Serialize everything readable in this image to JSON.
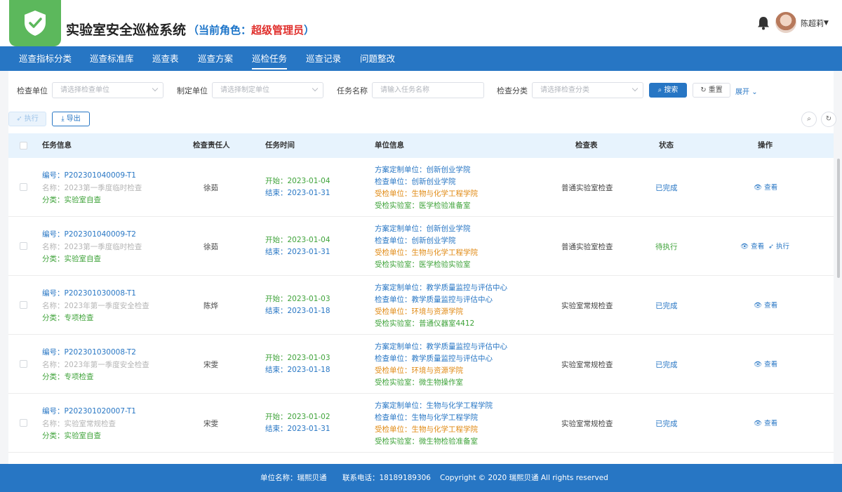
{
  "app": {
    "title": "实验室安全巡检系统",
    "role_prefix": "（当前角色：",
    "role_name": "超级管理员",
    "role_suffix": "）",
    "user_name": "陈超莉"
  },
  "nav": {
    "items": [
      "巡查指标分类",
      "巡查标准库",
      "巡查表",
      "巡查方案",
      "巡检任务",
      "巡查记录",
      "问题整改"
    ],
    "active": "巡检任务"
  },
  "filters": {
    "inspect_unit": {
      "label": "检查单位",
      "placeholder": "请选择检查单位"
    },
    "custom_unit": {
      "label": "制定单位",
      "placeholder": "请选择制定单位"
    },
    "task_name": {
      "label": "任务名称",
      "placeholder": "请输入任务名称"
    },
    "category": {
      "label": "检查分类",
      "placeholder": "请选择检查分类"
    },
    "search_label": "搜索",
    "reset_label": "重置",
    "expand_label": "展开"
  },
  "toolbar": {
    "execute_label": "执行",
    "export_label": "导出"
  },
  "table": {
    "headers": {
      "task": "任务信息",
      "person": "检查责任人",
      "time": "任务时间",
      "unit": "单位信息",
      "sheet": "检查表",
      "status": "状态",
      "action": "操作"
    },
    "rows": [
      {
        "code": "编号：P202301040009-T1",
        "name": "名称：2023第一季度临时检查",
        "category": "分类：实验室自查",
        "person": "徐茹",
        "start": "开始：2023-01-04",
        "end": "结束：2023-01-31",
        "plan_unit": "方案定制单位：创新创业学院",
        "inspect_unit": "检查单位：创新创业学院",
        "inspected_unit": "受检单位：生物与化学工程学院",
        "lab": "受检实验室：医学检验准备室",
        "sheet": "普通实验室检查",
        "status": "已完成",
        "status_type": "done",
        "view": "查看",
        "execute": ""
      },
      {
        "code": "编号：P202301040009-T2",
        "name": "名称：2023第一季度临时检查",
        "category": "分类：实验室自查",
        "person": "徐茹",
        "start": "开始：2023-01-04",
        "end": "结束：2023-01-31",
        "plan_unit": "方案定制单位：创新创业学院",
        "inspect_unit": "检查单位：创新创业学院",
        "inspected_unit": "受检单位：生物与化学工程学院",
        "lab": "受检实验室：医学检验实验室",
        "sheet": "普通实验室检查",
        "status": "待执行",
        "status_type": "wait",
        "view": "查看",
        "execute": "执行"
      },
      {
        "code": "编号：P202301030008-T1",
        "name": "名称：2023年第一季度安全检查",
        "category": "分类：专项检查",
        "person": "陈烨",
        "start": "开始：2023-01-03",
        "end": "结束：2023-01-18",
        "plan_unit": "方案定制单位：教学质量监控与评估中心",
        "inspect_unit": "检查单位：教学质量监控与评估中心",
        "inspected_unit": "受检单位：环境与资源学院",
        "lab": "受检实验室：普通仪器室4412",
        "sheet": "实验室常规检查",
        "status": "已完成",
        "status_type": "done",
        "view": "查看",
        "execute": ""
      },
      {
        "code": "编号：P202301030008-T2",
        "name": "名称：2023年第一季度安全检查",
        "category": "分类：专项检查",
        "person": "宋雯",
        "start": "开始：2023-01-03",
        "end": "结束：2023-01-18",
        "plan_unit": "方案定制单位：教学质量监控与评估中心",
        "inspect_unit": "检查单位：教学质量监控与评估中心",
        "inspected_unit": "受检单位：环境与资源学院",
        "lab": "受检实验室：微生物操作室",
        "sheet": "实验室常规检查",
        "status": "已完成",
        "status_type": "done",
        "view": "查看",
        "execute": ""
      },
      {
        "code": "编号：P202301020007-T1",
        "name": "名称：实验室常规检查",
        "category": "分类：实验室自查",
        "person": "宋雯",
        "start": "开始：2023-01-02",
        "end": "结束：2023-01-31",
        "plan_unit": "方案定制单位：生物与化学工程学院",
        "inspect_unit": "检查单位：生物与化学工程学院",
        "inspected_unit": "受检单位：生物与化学工程学院",
        "lab": "受检实验室：微生物检验准备室",
        "sheet": "实验室常规检查",
        "status": "已完成",
        "status_type": "done",
        "view": "查看",
        "execute": ""
      }
    ]
  },
  "footer": {
    "unit": "单位名称：瑞熙贝通",
    "phone": "联系电话：18189189306",
    "copyright": "Copyright © 2020 瑞熙贝通 All rights reserved"
  },
  "colors": {
    "primary": "#2776c4",
    "logo_green": "#5cb85c",
    "role_red": "#e0302d",
    "success_green": "#3fa33a",
    "unit_orange": "#e08a14"
  }
}
